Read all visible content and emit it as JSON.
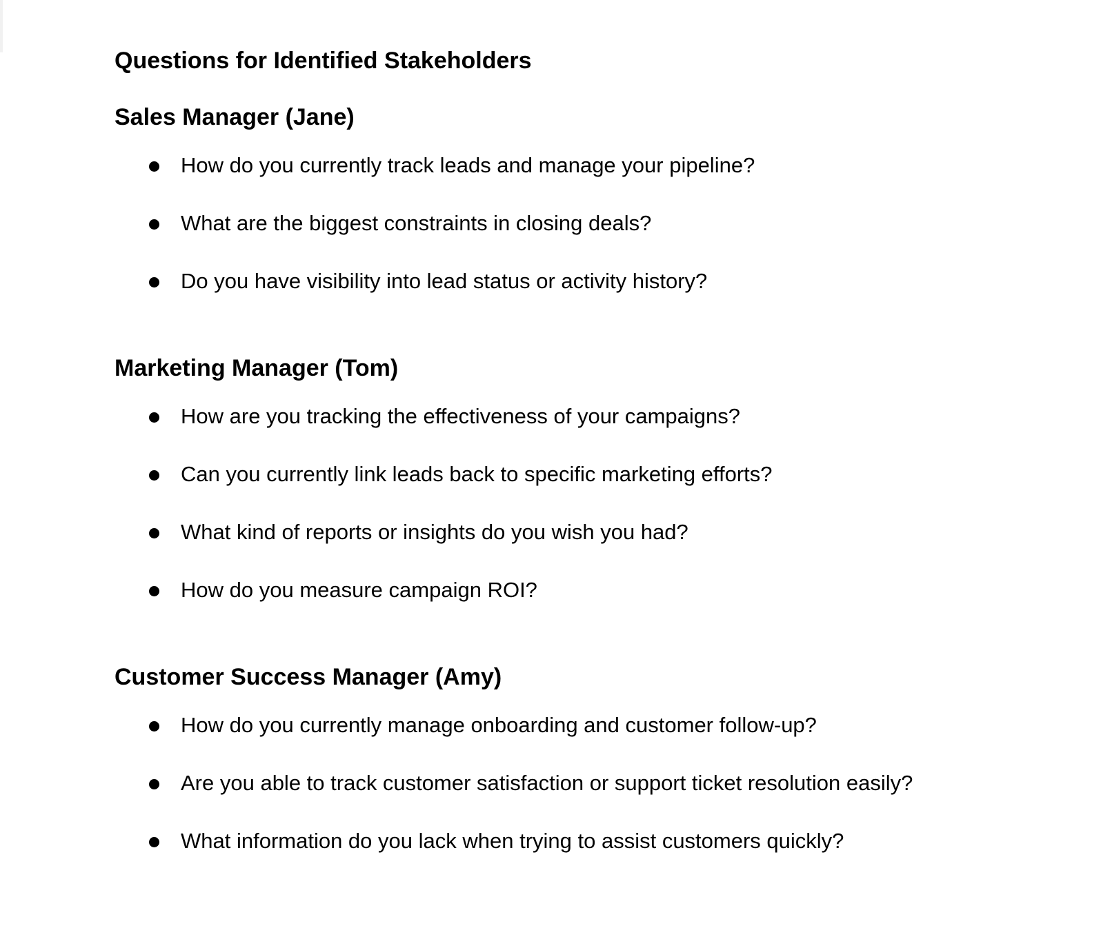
{
  "document": {
    "title": "Questions for Identified Stakeholders",
    "sections": [
      {
        "heading": "Sales Manager (Jane)",
        "questions": [
          "How do you currently track leads and manage your pipeline?",
          "What are the biggest constraints in closing deals?",
          "Do you have visibility into lead status or activity history?"
        ]
      },
      {
        "heading": "Marketing Manager (Tom)",
        "questions": [
          "How are you tracking the effectiveness of your campaigns?",
          "Can you currently link leads back to specific marketing efforts?",
          "What kind of reports or insights do you wish you had?",
          "How do you measure campaign ROI?"
        ]
      },
      {
        "heading": "Customer Success Manager (Amy)",
        "questions": [
          "How do you currently manage onboarding and customer follow-up?",
          "Are you able to track customer satisfaction or support ticket resolution easily?",
          "What information do you lack when trying to assist customers quickly?"
        ]
      }
    ]
  }
}
